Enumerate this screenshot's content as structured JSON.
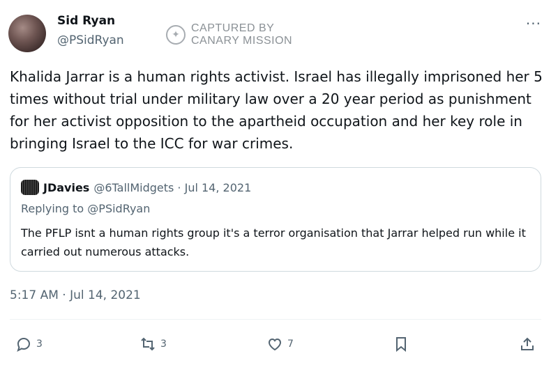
{
  "author": {
    "name": "Sid Ryan",
    "handle": "@PSidRyan"
  },
  "watermark": {
    "line1": "CAPTURED BY",
    "line2": "CANARY MISSION"
  },
  "more_label": "···",
  "tweet": {
    "text": "Khalida Jarrar is a human rights activist. Israel has illegally imprisoned her 5 times without trial under military law over a 20 year period as punishment for her activist opposition to the apartheid occupation and her key role in bringing Israel to the ICC for war crimes.",
    "timestamp": "5:17 AM · Jul 14, 2021"
  },
  "quoted": {
    "name": "JDavies",
    "handle_date": "@6TallMidgets · Jul 14, 2021",
    "replying_to": "Replying to @PSidRyan",
    "text": "The PFLP isnt a human rights group it's a terror organisation that Jarrar helped run while it carried out numerous attacks."
  },
  "actions": {
    "replies": "3",
    "retweets": "3",
    "likes": "7",
    "icons": [
      "reply-icon",
      "retweet-icon",
      "like-icon",
      "bookmark-icon",
      "share-icon"
    ]
  },
  "colors": {
    "text": "#0f1419",
    "muted": "#536471",
    "border": "#cfd9de"
  }
}
